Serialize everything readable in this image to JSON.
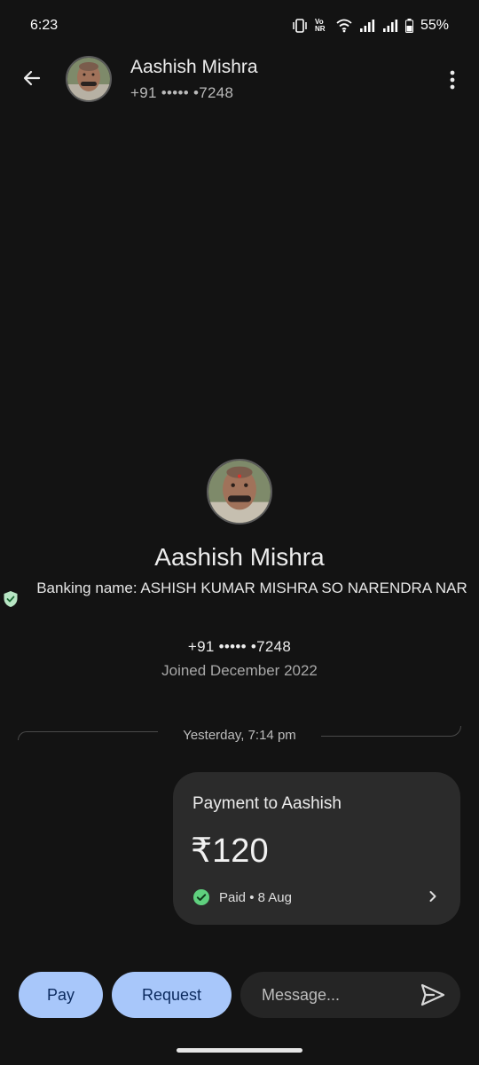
{
  "status_bar": {
    "time": "6:23",
    "network_label": "Vo NR",
    "battery": "55%"
  },
  "header": {
    "name": "Aashish Mishra",
    "phone": "+91 ••••• •7248"
  },
  "profile": {
    "name": "Aashish Mishra",
    "banking_name": "Banking name: ASHISH KUMAR MISHRA SO NARENDRA NAR",
    "phone": "+91 ••••• •7248",
    "joined": "Joined December 2022"
  },
  "chat": {
    "date_divider": "Yesterday, 7:14 pm",
    "payment": {
      "title": "Payment to Aashish",
      "amount": "₹120",
      "status": "Paid • 8 Aug"
    }
  },
  "actions": {
    "pay_label": "Pay",
    "request_label": "Request",
    "message_placeholder": "Message..."
  },
  "colors": {
    "background": "#131313",
    "accent_button": "#a8c7fa",
    "card": "#2b2b2b",
    "success_green": "#5fd07e"
  }
}
